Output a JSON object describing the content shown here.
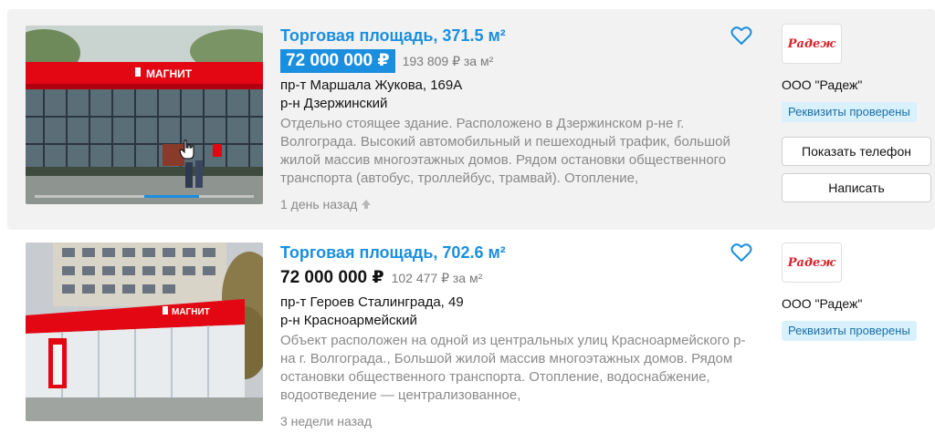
{
  "listings": [
    {
      "title": "Торговая площадь, 371.5 м²",
      "price": "72 000 000 ₽",
      "price_per_m2": "193 809 ₽ за м²",
      "address": "пр-т Маршала Жукова, 169А",
      "district": "р-н Дзержинский",
      "description": "Отдельно стоящее здание. Расположено в Дзержинском р-не г. Волгограда. Высокий автомобильный и пешеходный трафик, большой жилой массив многоэтажных домов. Рядом остановки общественного транспорта (автобус, троллейбус, трамвай). Отопление,",
      "date": "1 день назад",
      "store_sign": "МАГНИТ",
      "seller": {
        "logo_text": "Радеж",
        "name": "ООО \"Радеж\"",
        "badge": "Реквизиты проверены",
        "phone_button": "Показать телефон",
        "write_button": "Написать"
      }
    },
    {
      "title": "Торговая площадь, 702.6 м²",
      "price": "72 000 000 ₽",
      "price_per_m2": "102 477 ₽ за м²",
      "address": "пр-т Героев Сталинграда, 49",
      "district": "р-н Красноармейский",
      "description": "Объект расположен на одной из центральных улиц Красноармейского р-на г. Волгограда., Большой жилой массив многоэтажных домов. Рядом остановки общественного транспорта. Отопление, водоснабжение, водоотведение — централизованное,",
      "date": "3 недели назад",
      "store_sign": "МАГНИТ",
      "seller": {
        "logo_text": "Радеж",
        "name": "ООО \"Радеж\"",
        "badge": "Реквизиты проверены"
      }
    }
  ],
  "icons": {
    "favorite": "heart-outline-icon",
    "raised": "arrow-up-icon",
    "cursor": "hand-pointer-icon"
  },
  "colors": {
    "accent": "#1a8fe0",
    "badge_bg": "#d9f1fc",
    "magnit_red": "#e30613"
  }
}
